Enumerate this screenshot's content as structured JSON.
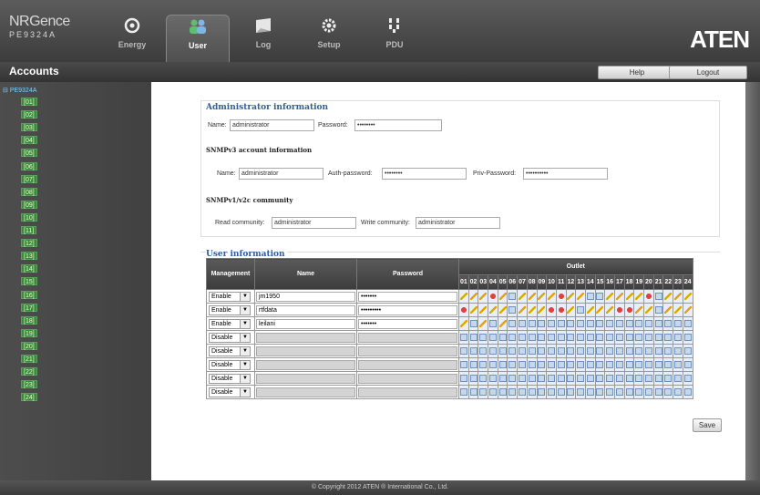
{
  "brand": {
    "logo_line1": "NRGence",
    "logo_line2": "PE9324A",
    "aten": "ATEN"
  },
  "nav": [
    {
      "label": "Energy",
      "icon": "energy-icon"
    },
    {
      "label": "User",
      "icon": "users-icon",
      "active": true
    },
    {
      "label": "Log",
      "icon": "log-icon"
    },
    {
      "label": "Setup",
      "icon": "gear-icon"
    },
    {
      "label": "PDU",
      "icon": "pdu-icon"
    }
  ],
  "header": {
    "title": "Accounts",
    "help": "Help",
    "logout": "Logout"
  },
  "tree": {
    "root": "PE9324A",
    "items": [
      "[01]",
      "[02]",
      "[03]",
      "[04]",
      "[05]",
      "[06]",
      "[07]",
      "[08]",
      "[09]",
      "[10]",
      "[11]",
      "[12]",
      "[13]",
      "[14]",
      "[15]",
      "[16]",
      "[17]",
      "[18]",
      "[19]",
      "[20]",
      "[21]",
      "[22]",
      "[23]",
      "[24]"
    ]
  },
  "admin": {
    "title": "Administrator information",
    "name_label": "Name:",
    "name_value": "administrator",
    "password_label": "Password:",
    "password_value": "••••••••"
  },
  "snmpv3": {
    "title": "SNMPv3 account information",
    "name_label": "Name:",
    "name_value": "administrator",
    "auth_label": "Auth-password:",
    "auth_value": "••••••••",
    "priv_label": "Priv-Password:",
    "priv_value": "••••••••••"
  },
  "snmpv1": {
    "title": "SNMPv1/v2c community",
    "read_label": "Read community:",
    "read_value": "administrator",
    "write_label": "Write community:",
    "write_value": "administrator"
  },
  "users": {
    "title": "User information",
    "col_management": "Management",
    "col_name": "Name",
    "col_password": "Password",
    "col_outlet": "Outlet",
    "outlets": [
      "01",
      "02",
      "03",
      "04",
      "05",
      "06",
      "07",
      "08",
      "09",
      "10",
      "11",
      "12",
      "13",
      "14",
      "15",
      "16",
      "17",
      "18",
      "19",
      "20",
      "21",
      "22",
      "23",
      "24"
    ],
    "rows": [
      {
        "mgmt": "Enable",
        "name": "jm1950",
        "password": "•••••••",
        "disabled": false,
        "outlets": "kkknkxkkkknkkxxkkkknxkkk"
      },
      {
        "mgmt": "Enable",
        "name": "rtfdata",
        "password": "•••••••••",
        "disabled": false,
        "outlets": "nkkkkxkkknnkxkkknnkkxkkk"
      },
      {
        "mgmt": "Enable",
        "name": "leilani",
        "password": "•••••••",
        "disabled": false,
        "outlets": "kxkxkxxxxxxxxxxxxxxxxxxx"
      },
      {
        "mgmt": "Disable",
        "name": "",
        "password": "",
        "disabled": true,
        "outlets": "xxxxxxxxxxxxxxxxxxxxxxxx"
      },
      {
        "mgmt": "Disable",
        "name": "",
        "password": "",
        "disabled": true,
        "outlets": "xxxxxxxxxxxxxxxxxxxxxxxx"
      },
      {
        "mgmt": "Disable",
        "name": "",
        "password": "",
        "disabled": true,
        "outlets": "xxxxxxxxxxxxxxxxxxxxxxxx"
      },
      {
        "mgmt": "Disable",
        "name": "",
        "password": "",
        "disabled": true,
        "outlets": "xxxxxxxxxxxxxxxxxxxxxxxx"
      },
      {
        "mgmt": "Disable",
        "name": "",
        "password": "",
        "disabled": true,
        "outlets": "xxxxxxxxxxxxxxxxxxxxxxxx"
      }
    ]
  },
  "save": "Save",
  "footer": "© Copyright 2012 ATEN ® International Co., Ltd."
}
